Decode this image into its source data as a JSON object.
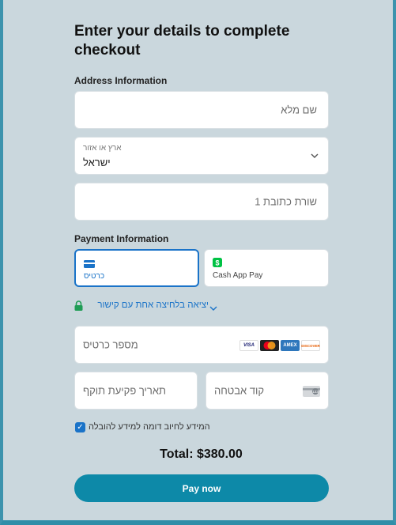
{
  "checkout": {
    "title": "Enter your details to complete checkout",
    "address_section": "Address Information",
    "full_name_placeholder": "שם מלא",
    "country_label": "ארץ או אזור",
    "country_value": "ישראל",
    "address_line1_placeholder": "שורת כתובת 1",
    "payment_section": "Payment Information",
    "payment_tabs": [
      {
        "label": "כרטיס",
        "icon": "credit-card-icon",
        "selected": true
      },
      {
        "label": "Cash App Pay",
        "icon": "cash-app-icon",
        "selected": false
      }
    ],
    "one_click_link": "יציאה בלחיצה אחת עם קישור",
    "card_number_placeholder": "מספר כרטיס",
    "card_brands": [
      "VISA",
      "mastercard",
      "AMEX",
      "DISCOVER"
    ],
    "expiry_placeholder": "תאריך פקיעת תוקף",
    "cvc_placeholder": "קוד אבטחה",
    "billing_same_label": "המידע לחיוב דומה למידע להובלה",
    "billing_same_checked": true,
    "total": "Total: $380.00",
    "pay_button": "Pay now"
  },
  "colors": {
    "background": "#cad7dd",
    "accent": "#1a73c8",
    "pay_button": "#0d89a8",
    "lock_green": "#1f9d55",
    "cash_app_green": "#00c244"
  }
}
